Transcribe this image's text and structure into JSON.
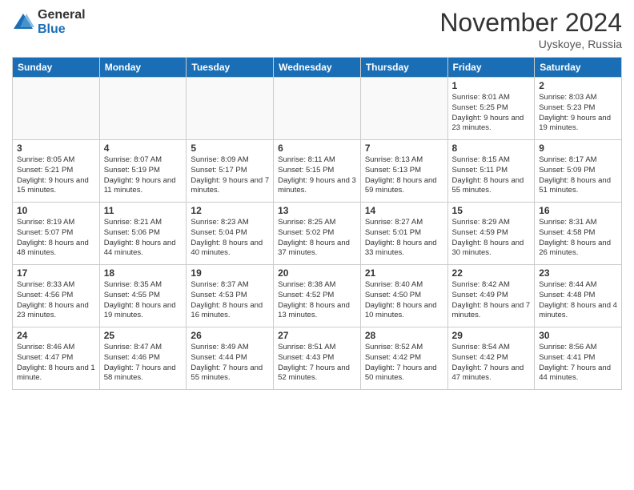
{
  "header": {
    "logo_general": "General",
    "logo_blue": "Blue",
    "month_title": "November 2024",
    "location": "Uyskoye, Russia"
  },
  "days_of_week": [
    "Sunday",
    "Monday",
    "Tuesday",
    "Wednesday",
    "Thursday",
    "Friday",
    "Saturday"
  ],
  "weeks": [
    [
      {
        "day": "",
        "info": ""
      },
      {
        "day": "",
        "info": ""
      },
      {
        "day": "",
        "info": ""
      },
      {
        "day": "",
        "info": ""
      },
      {
        "day": "",
        "info": ""
      },
      {
        "day": "1",
        "info": "Sunrise: 8:01 AM\nSunset: 5:25 PM\nDaylight: 9 hours and 23 minutes."
      },
      {
        "day": "2",
        "info": "Sunrise: 8:03 AM\nSunset: 5:23 PM\nDaylight: 9 hours and 19 minutes."
      }
    ],
    [
      {
        "day": "3",
        "info": "Sunrise: 8:05 AM\nSunset: 5:21 PM\nDaylight: 9 hours and 15 minutes."
      },
      {
        "day": "4",
        "info": "Sunrise: 8:07 AM\nSunset: 5:19 PM\nDaylight: 9 hours and 11 minutes."
      },
      {
        "day": "5",
        "info": "Sunrise: 8:09 AM\nSunset: 5:17 PM\nDaylight: 9 hours and 7 minutes."
      },
      {
        "day": "6",
        "info": "Sunrise: 8:11 AM\nSunset: 5:15 PM\nDaylight: 9 hours and 3 minutes."
      },
      {
        "day": "7",
        "info": "Sunrise: 8:13 AM\nSunset: 5:13 PM\nDaylight: 8 hours and 59 minutes."
      },
      {
        "day": "8",
        "info": "Sunrise: 8:15 AM\nSunset: 5:11 PM\nDaylight: 8 hours and 55 minutes."
      },
      {
        "day": "9",
        "info": "Sunrise: 8:17 AM\nSunset: 5:09 PM\nDaylight: 8 hours and 51 minutes."
      }
    ],
    [
      {
        "day": "10",
        "info": "Sunrise: 8:19 AM\nSunset: 5:07 PM\nDaylight: 8 hours and 48 minutes."
      },
      {
        "day": "11",
        "info": "Sunrise: 8:21 AM\nSunset: 5:06 PM\nDaylight: 8 hours and 44 minutes."
      },
      {
        "day": "12",
        "info": "Sunrise: 8:23 AM\nSunset: 5:04 PM\nDaylight: 8 hours and 40 minutes."
      },
      {
        "day": "13",
        "info": "Sunrise: 8:25 AM\nSunset: 5:02 PM\nDaylight: 8 hours and 37 minutes."
      },
      {
        "day": "14",
        "info": "Sunrise: 8:27 AM\nSunset: 5:01 PM\nDaylight: 8 hours and 33 minutes."
      },
      {
        "day": "15",
        "info": "Sunrise: 8:29 AM\nSunset: 4:59 PM\nDaylight: 8 hours and 30 minutes."
      },
      {
        "day": "16",
        "info": "Sunrise: 8:31 AM\nSunset: 4:58 PM\nDaylight: 8 hours and 26 minutes."
      }
    ],
    [
      {
        "day": "17",
        "info": "Sunrise: 8:33 AM\nSunset: 4:56 PM\nDaylight: 8 hours and 23 minutes."
      },
      {
        "day": "18",
        "info": "Sunrise: 8:35 AM\nSunset: 4:55 PM\nDaylight: 8 hours and 19 minutes."
      },
      {
        "day": "19",
        "info": "Sunrise: 8:37 AM\nSunset: 4:53 PM\nDaylight: 8 hours and 16 minutes."
      },
      {
        "day": "20",
        "info": "Sunrise: 8:38 AM\nSunset: 4:52 PM\nDaylight: 8 hours and 13 minutes."
      },
      {
        "day": "21",
        "info": "Sunrise: 8:40 AM\nSunset: 4:50 PM\nDaylight: 8 hours and 10 minutes."
      },
      {
        "day": "22",
        "info": "Sunrise: 8:42 AM\nSunset: 4:49 PM\nDaylight: 8 hours and 7 minutes."
      },
      {
        "day": "23",
        "info": "Sunrise: 8:44 AM\nSunset: 4:48 PM\nDaylight: 8 hours and 4 minutes."
      }
    ],
    [
      {
        "day": "24",
        "info": "Sunrise: 8:46 AM\nSunset: 4:47 PM\nDaylight: 8 hours and 1 minute."
      },
      {
        "day": "25",
        "info": "Sunrise: 8:47 AM\nSunset: 4:46 PM\nDaylight: 7 hours and 58 minutes."
      },
      {
        "day": "26",
        "info": "Sunrise: 8:49 AM\nSunset: 4:44 PM\nDaylight: 7 hours and 55 minutes."
      },
      {
        "day": "27",
        "info": "Sunrise: 8:51 AM\nSunset: 4:43 PM\nDaylight: 7 hours and 52 minutes."
      },
      {
        "day": "28",
        "info": "Sunrise: 8:52 AM\nSunset: 4:42 PM\nDaylight: 7 hours and 50 minutes."
      },
      {
        "day": "29",
        "info": "Sunrise: 8:54 AM\nSunset: 4:42 PM\nDaylight: 7 hours and 47 minutes."
      },
      {
        "day": "30",
        "info": "Sunrise: 8:56 AM\nSunset: 4:41 PM\nDaylight: 7 hours and 44 minutes."
      }
    ]
  ]
}
